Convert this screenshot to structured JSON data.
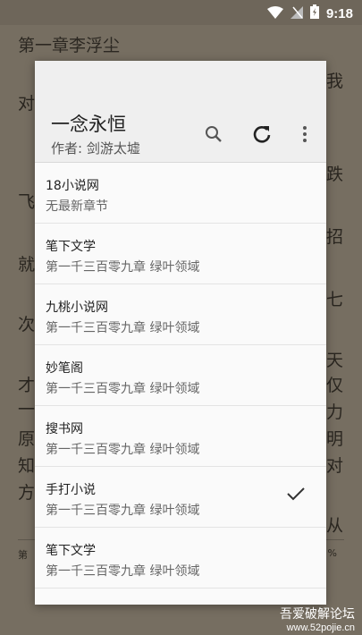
{
  "status_bar": {
    "time": "9:18",
    "icons": [
      "wifi-icon",
      "no-sim-icon",
      "battery-icon"
    ]
  },
  "reader": {
    "chapter_title": "第一章李浮尘",
    "left_chars": [
      "对",
      "飞",
      "就",
      "次",
      "才",
      "一",
      "原",
      "知",
      "方"
    ],
    "right_chars": [
      "我",
      "跌",
      "招",
      "七",
      "天",
      "仅",
      "力",
      "明",
      "对",
      "从"
    ],
    "footer_left": "第",
    "footer_right": "%"
  },
  "dialog": {
    "book_title": "一念永恒",
    "author": "作者: 剑游太墟",
    "sources": [
      {
        "name": "18小说网",
        "latest": "无最新章节",
        "selected": false
      },
      {
        "name": "笔下文学",
        "latest": "第一千三百零九章 绿叶领域",
        "selected": false
      },
      {
        "name": "九桃小说网",
        "latest": "第一千三百零九章 绿叶领域",
        "selected": false
      },
      {
        "name": "妙笔阁",
        "latest": "第一千三百零九章 绿叶领域",
        "selected": false
      },
      {
        "name": "搜书网",
        "latest": "第一千三百零九章 绿叶领域",
        "selected": false
      },
      {
        "name": "手打小说",
        "latest": "第一千三百零九章 绿叶领域",
        "selected": true
      },
      {
        "name": "笔下文学",
        "latest": "第一千三百零九章 绿叶领域",
        "selected": false
      },
      {
        "name": "",
        "latest": "",
        "selected": false
      }
    ]
  },
  "watermark": {
    "title": "吾爱破解论坛",
    "url": "www.52pojie.cn"
  }
}
